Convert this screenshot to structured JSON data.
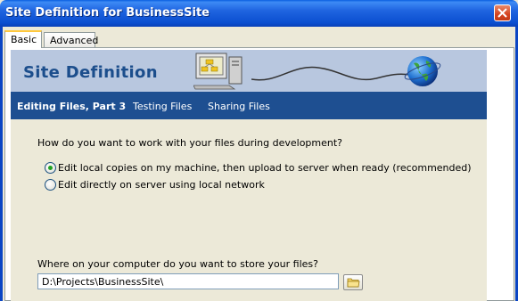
{
  "window": {
    "title": "Site Definition for BusinessSite"
  },
  "tabs": [
    {
      "label": "Basic",
      "active": true
    },
    {
      "label": "Advanced",
      "active": false
    }
  ],
  "banner": {
    "title": "Site Definition"
  },
  "steps": [
    {
      "label": "Editing Files, Part 3",
      "active": true
    },
    {
      "label": "Testing Files",
      "active": false
    },
    {
      "label": "Sharing Files",
      "active": false
    }
  ],
  "question": "How do you want to work with your files during development?",
  "options": [
    {
      "label": "Edit local copies on my machine, then upload to server when ready (recommended)",
      "selected": true
    },
    {
      "label": "Edit directly on server using local network",
      "selected": false
    }
  ],
  "location": {
    "question": "Where on your computer do you want to store your files?",
    "value": "D:\\Projects\\BusinessSite\\"
  },
  "icons": {
    "close": "close-icon",
    "computer": "computer-icon",
    "globe": "globe-icon",
    "folder": "folder-icon"
  },
  "colors": {
    "title_bar": "#0A5FE0",
    "banner": "#B8C7DF",
    "nav": "#1E4F91",
    "tab_highlight": "#FFC83C",
    "radio_dot": "#21A121"
  }
}
